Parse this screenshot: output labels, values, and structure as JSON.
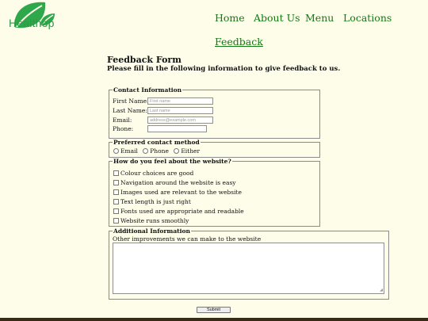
{
  "brand": {
    "logo_text": "Healthop"
  },
  "nav": {
    "items": [
      "Home",
      "About Us",
      "Menu",
      "Locations"
    ],
    "feedback": "Feedback"
  },
  "form": {
    "title": "Feedback Form",
    "subtitle": "Please fill in the following information to give feedback to us.",
    "contact": {
      "legend": "Contact Information",
      "first_name_label": "First Name:",
      "first_name_placeholder": "First name",
      "last_name_label": "Last Name:",
      "last_name_placeholder": "Last name",
      "email_label": "Email:",
      "email_placeholder": "address@example.com",
      "phone_label": "Phone:",
      "phone_value": ""
    },
    "method": {
      "legend": "Preferred contact method",
      "options": [
        "Email",
        "Phone",
        "Either"
      ]
    },
    "website": {
      "legend": "How do you feel about the website?",
      "options": [
        "Colour choices are good",
        "Navigation around the website is easy",
        "Images used are relevant to the website",
        "Text length is just right",
        "Fonts used are appropriate and readable",
        "Website runs smoothly"
      ]
    },
    "additional": {
      "legend": "Additional Information",
      "label": "Other improvements we can make to the website",
      "value": ""
    },
    "submit_label": "Submit"
  },
  "colors": {
    "background": "#fdfde9",
    "nav_link": "#137a13",
    "logo_green": "#2a9a43",
    "footer": "#3a2a17"
  }
}
